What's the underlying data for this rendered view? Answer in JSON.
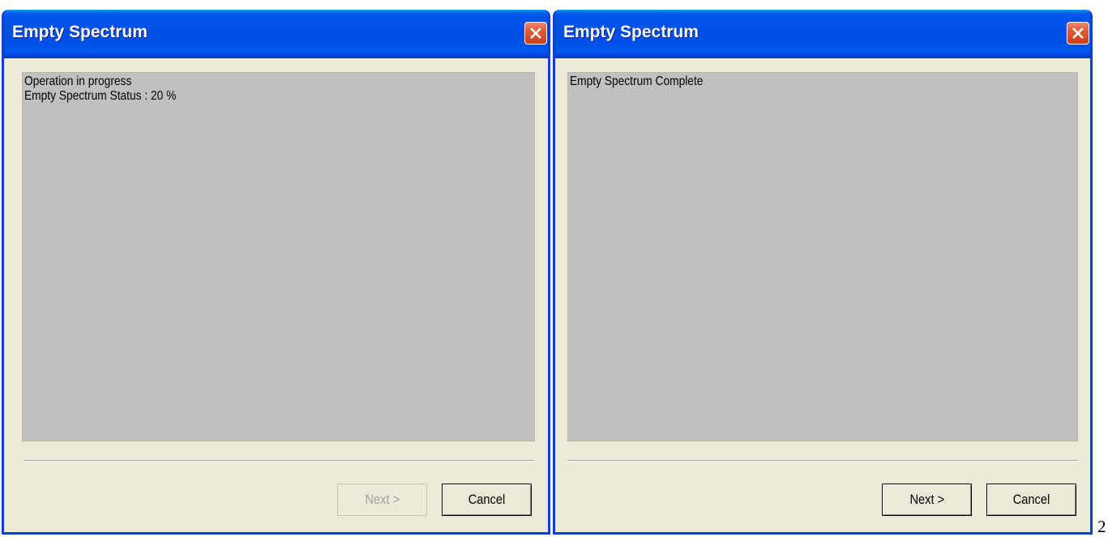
{
  "dialogs": [
    {
      "title": "Empty Spectrum",
      "content_lines": [
        "Operation in progress",
        "Empty Spectrum Status : 20 %"
      ],
      "next_label": "Next >",
      "next_enabled": false,
      "cancel_label": "Cancel"
    },
    {
      "title": "Empty Spectrum",
      "content_lines": [
        "Empty Spectrum Complete"
      ],
      "next_label": "Next >",
      "next_enabled": true,
      "cancel_label": "Cancel"
    }
  ],
  "page_number": "2",
  "icons": {
    "close": "close-icon"
  },
  "colors": {
    "titlebar": "#0054e3",
    "dialog_background": "#ece9d8",
    "content_background": "#c0c0c0",
    "close_button": "#e05a34",
    "disabled_text": "#a0a0a0"
  }
}
